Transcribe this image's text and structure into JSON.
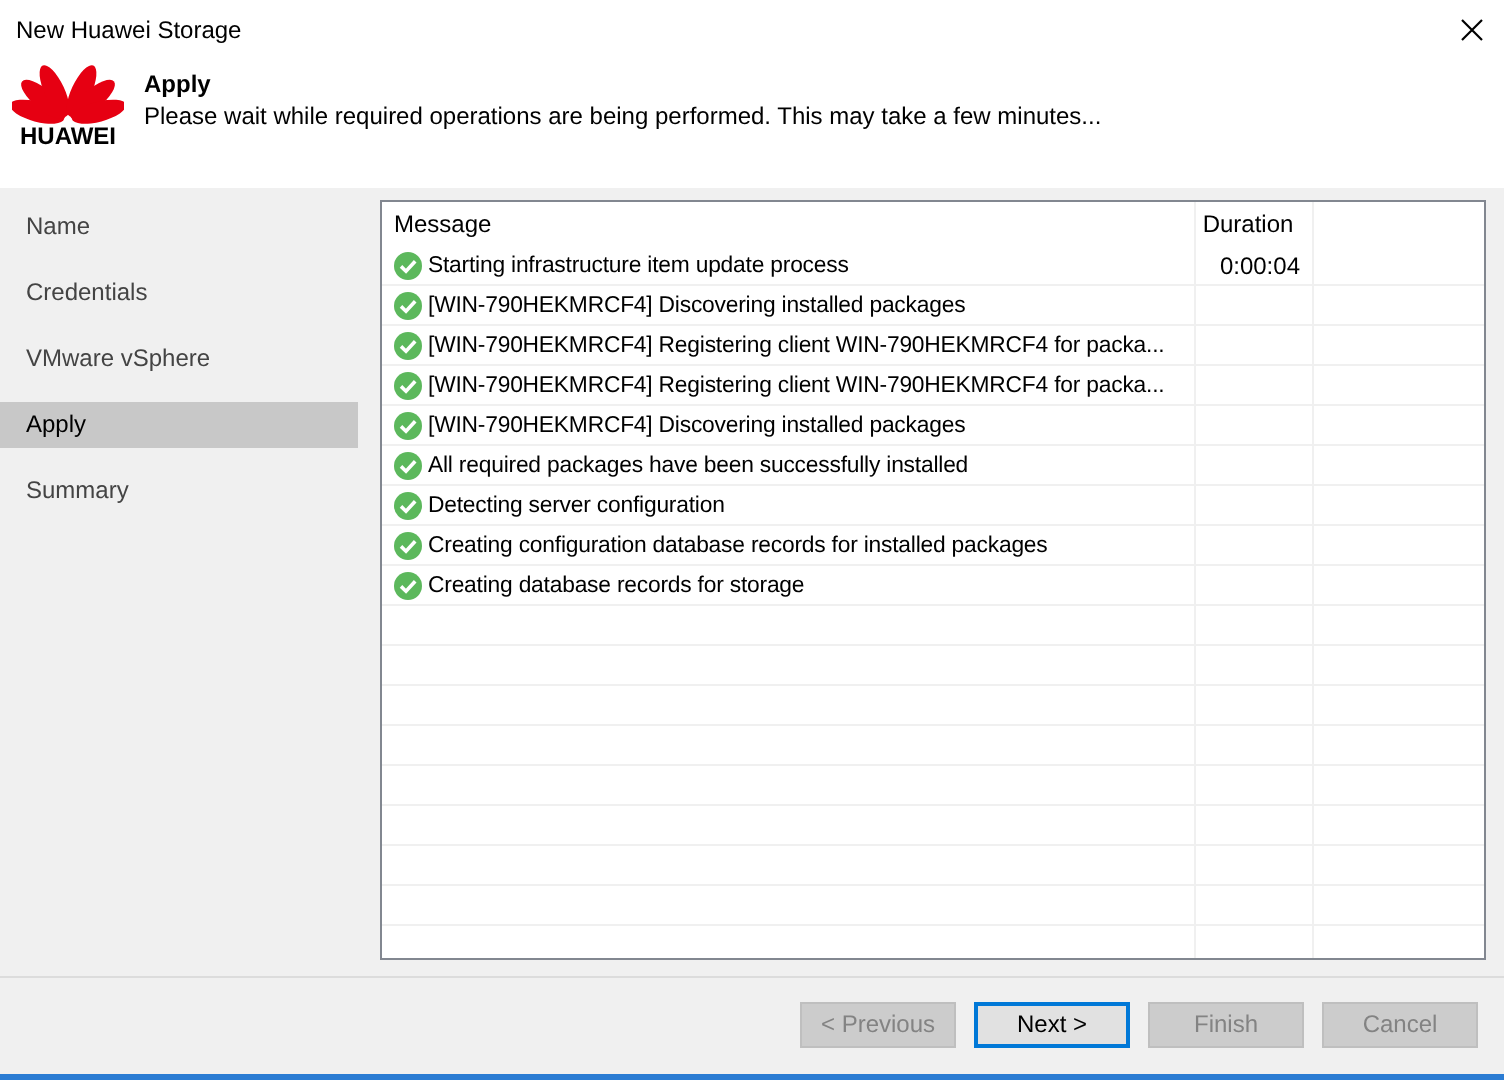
{
  "window": {
    "title": "New Huawei Storage"
  },
  "header": {
    "logo_text": "HUAWEI",
    "title": "Apply",
    "subtitle": "Please wait while required operations are being performed. This may take a few minutes..."
  },
  "sidebar": {
    "items": [
      {
        "label": "Name",
        "selected": false
      },
      {
        "label": "Credentials",
        "selected": false
      },
      {
        "label": "VMware vSphere",
        "selected": false
      },
      {
        "label": "Apply",
        "selected": true
      },
      {
        "label": "Summary",
        "selected": false
      }
    ]
  },
  "table": {
    "columns": [
      "Message",
      "Duration"
    ],
    "rows": [
      {
        "kind": "success",
        "message": "Starting infrastructure item update process",
        "duration": "0:00:04"
      },
      {
        "kind": "success",
        "message": "[WIN-790HEKMRCF4] Discovering installed packages"
      },
      {
        "kind": "success",
        "message": "[WIN-790HEKMRCF4] Registering client WIN-790HEKMRCF4 for packa..."
      },
      {
        "kind": "success",
        "message": "[WIN-790HEKMRCF4] Registering client WIN-790HEKMRCF4 for packa..."
      },
      {
        "kind": "success",
        "message": "[WIN-790HEKMRCF4] Discovering installed packages"
      },
      {
        "kind": "success",
        "message": "All required packages have been successfully installed"
      },
      {
        "kind": "success",
        "message": "Detecting server configuration"
      },
      {
        "kind": "success",
        "message": "Creating configuration database records for installed packages"
      },
      {
        "kind": "success",
        "message": "Creating database records for storage"
      }
    ]
  },
  "buttons": [
    {
      "label": "< Previous",
      "disabled": true,
      "focused": false
    },
    {
      "label": "Next >",
      "disabled": false,
      "focused": true
    },
    {
      "label": "Finish",
      "disabled": true,
      "focused": false
    },
    {
      "label": "Cancel",
      "disabled": true,
      "focused": false
    }
  ]
}
